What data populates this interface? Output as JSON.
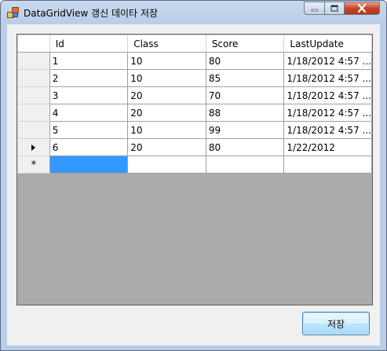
{
  "window": {
    "title": "DataGridView 갱신 데이타 저장",
    "icon": "app-window-icon",
    "controls": [
      "minimize-icon",
      "maximize-icon",
      "close-icon"
    ]
  },
  "grid": {
    "columns": [
      "Id",
      "Class",
      "Score",
      "LastUpdate"
    ],
    "rows": [
      {
        "indicator": "",
        "cells": [
          "1",
          "10",
          "80",
          "1/18/2012 4:57 ..."
        ]
      },
      {
        "indicator": "",
        "cells": [
          "2",
          "10",
          "85",
          "1/18/2012 4:57 ..."
        ]
      },
      {
        "indicator": "",
        "cells": [
          "3",
          "20",
          "70",
          "1/18/2012 4:57 ..."
        ]
      },
      {
        "indicator": "",
        "cells": [
          "4",
          "20",
          "88",
          "1/18/2012 4:57 ..."
        ]
      },
      {
        "indicator": "",
        "cells": [
          "5",
          "10",
          "99",
          "1/18/2012 4:57 ..."
        ]
      },
      {
        "indicator": "current-row-arrow",
        "cells": [
          "6",
          "20",
          "80",
          "1/22/2012"
        ]
      }
    ],
    "new_row": {
      "indicator": "*",
      "cells": [
        "",
        "",
        "",
        ""
      ]
    }
  },
  "buttons": {
    "save_label": "저장"
  },
  "colors": {
    "selection": "#3399ff",
    "grid_background": "#ababab",
    "close_button": "#c4462a"
  }
}
